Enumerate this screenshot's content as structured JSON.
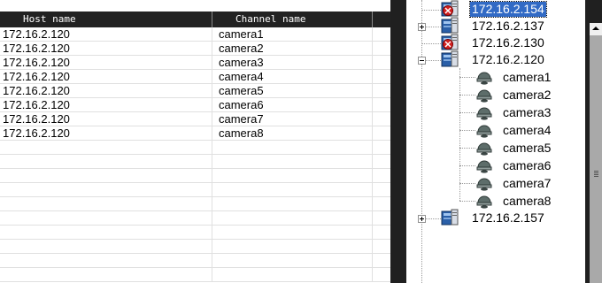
{
  "table": {
    "columns": {
      "host": "Host name",
      "channel": "Channel name"
    },
    "rows": [
      {
        "host": "172.16.2.120",
        "channel": "camera1"
      },
      {
        "host": "172.16.2.120",
        "channel": "camera2"
      },
      {
        "host": "172.16.2.120",
        "channel": "camera3"
      },
      {
        "host": "172.16.2.120",
        "channel": "camera4"
      },
      {
        "host": "172.16.2.120",
        "channel": "camera5"
      },
      {
        "host": "172.16.2.120",
        "channel": "camera6"
      },
      {
        "host": "172.16.2.120",
        "channel": "camera7"
      },
      {
        "host": "172.16.2.120",
        "channel": "camera8"
      },
      {
        "host": "",
        "channel": ""
      },
      {
        "host": "",
        "channel": ""
      },
      {
        "host": "",
        "channel": ""
      },
      {
        "host": "",
        "channel": ""
      },
      {
        "host": "",
        "channel": ""
      },
      {
        "host": "",
        "channel": ""
      },
      {
        "host": "",
        "channel": ""
      },
      {
        "host": "",
        "channel": ""
      },
      {
        "host": "",
        "channel": ""
      },
      {
        "host": "",
        "channel": ""
      }
    ]
  },
  "tree": {
    "hosts": [
      {
        "label": "172.16.2.154",
        "icon": "host-offline-icon",
        "selected": true
      },
      {
        "label": "172.16.2.137",
        "icon": "host-online-icon",
        "expander": "plus"
      },
      {
        "label": "172.16.2.130",
        "icon": "host-offline-icon"
      },
      {
        "label": "172.16.2.120",
        "icon": "host-online-icon",
        "expander": "minus"
      },
      {
        "label": "172.16.2.157",
        "icon": "host-online-icon",
        "expander": "plus"
      }
    ],
    "cameras": [
      "camera1",
      "camera2",
      "camera3",
      "camera4",
      "camera5",
      "camera6",
      "camera7",
      "camera8"
    ],
    "camera_icon": "dome-camera-icon"
  },
  "colors": {
    "selection": "#316ac5",
    "header_bg": "#222222",
    "panel_gap": "#202020",
    "scroll_track": "#a9a9a9"
  }
}
